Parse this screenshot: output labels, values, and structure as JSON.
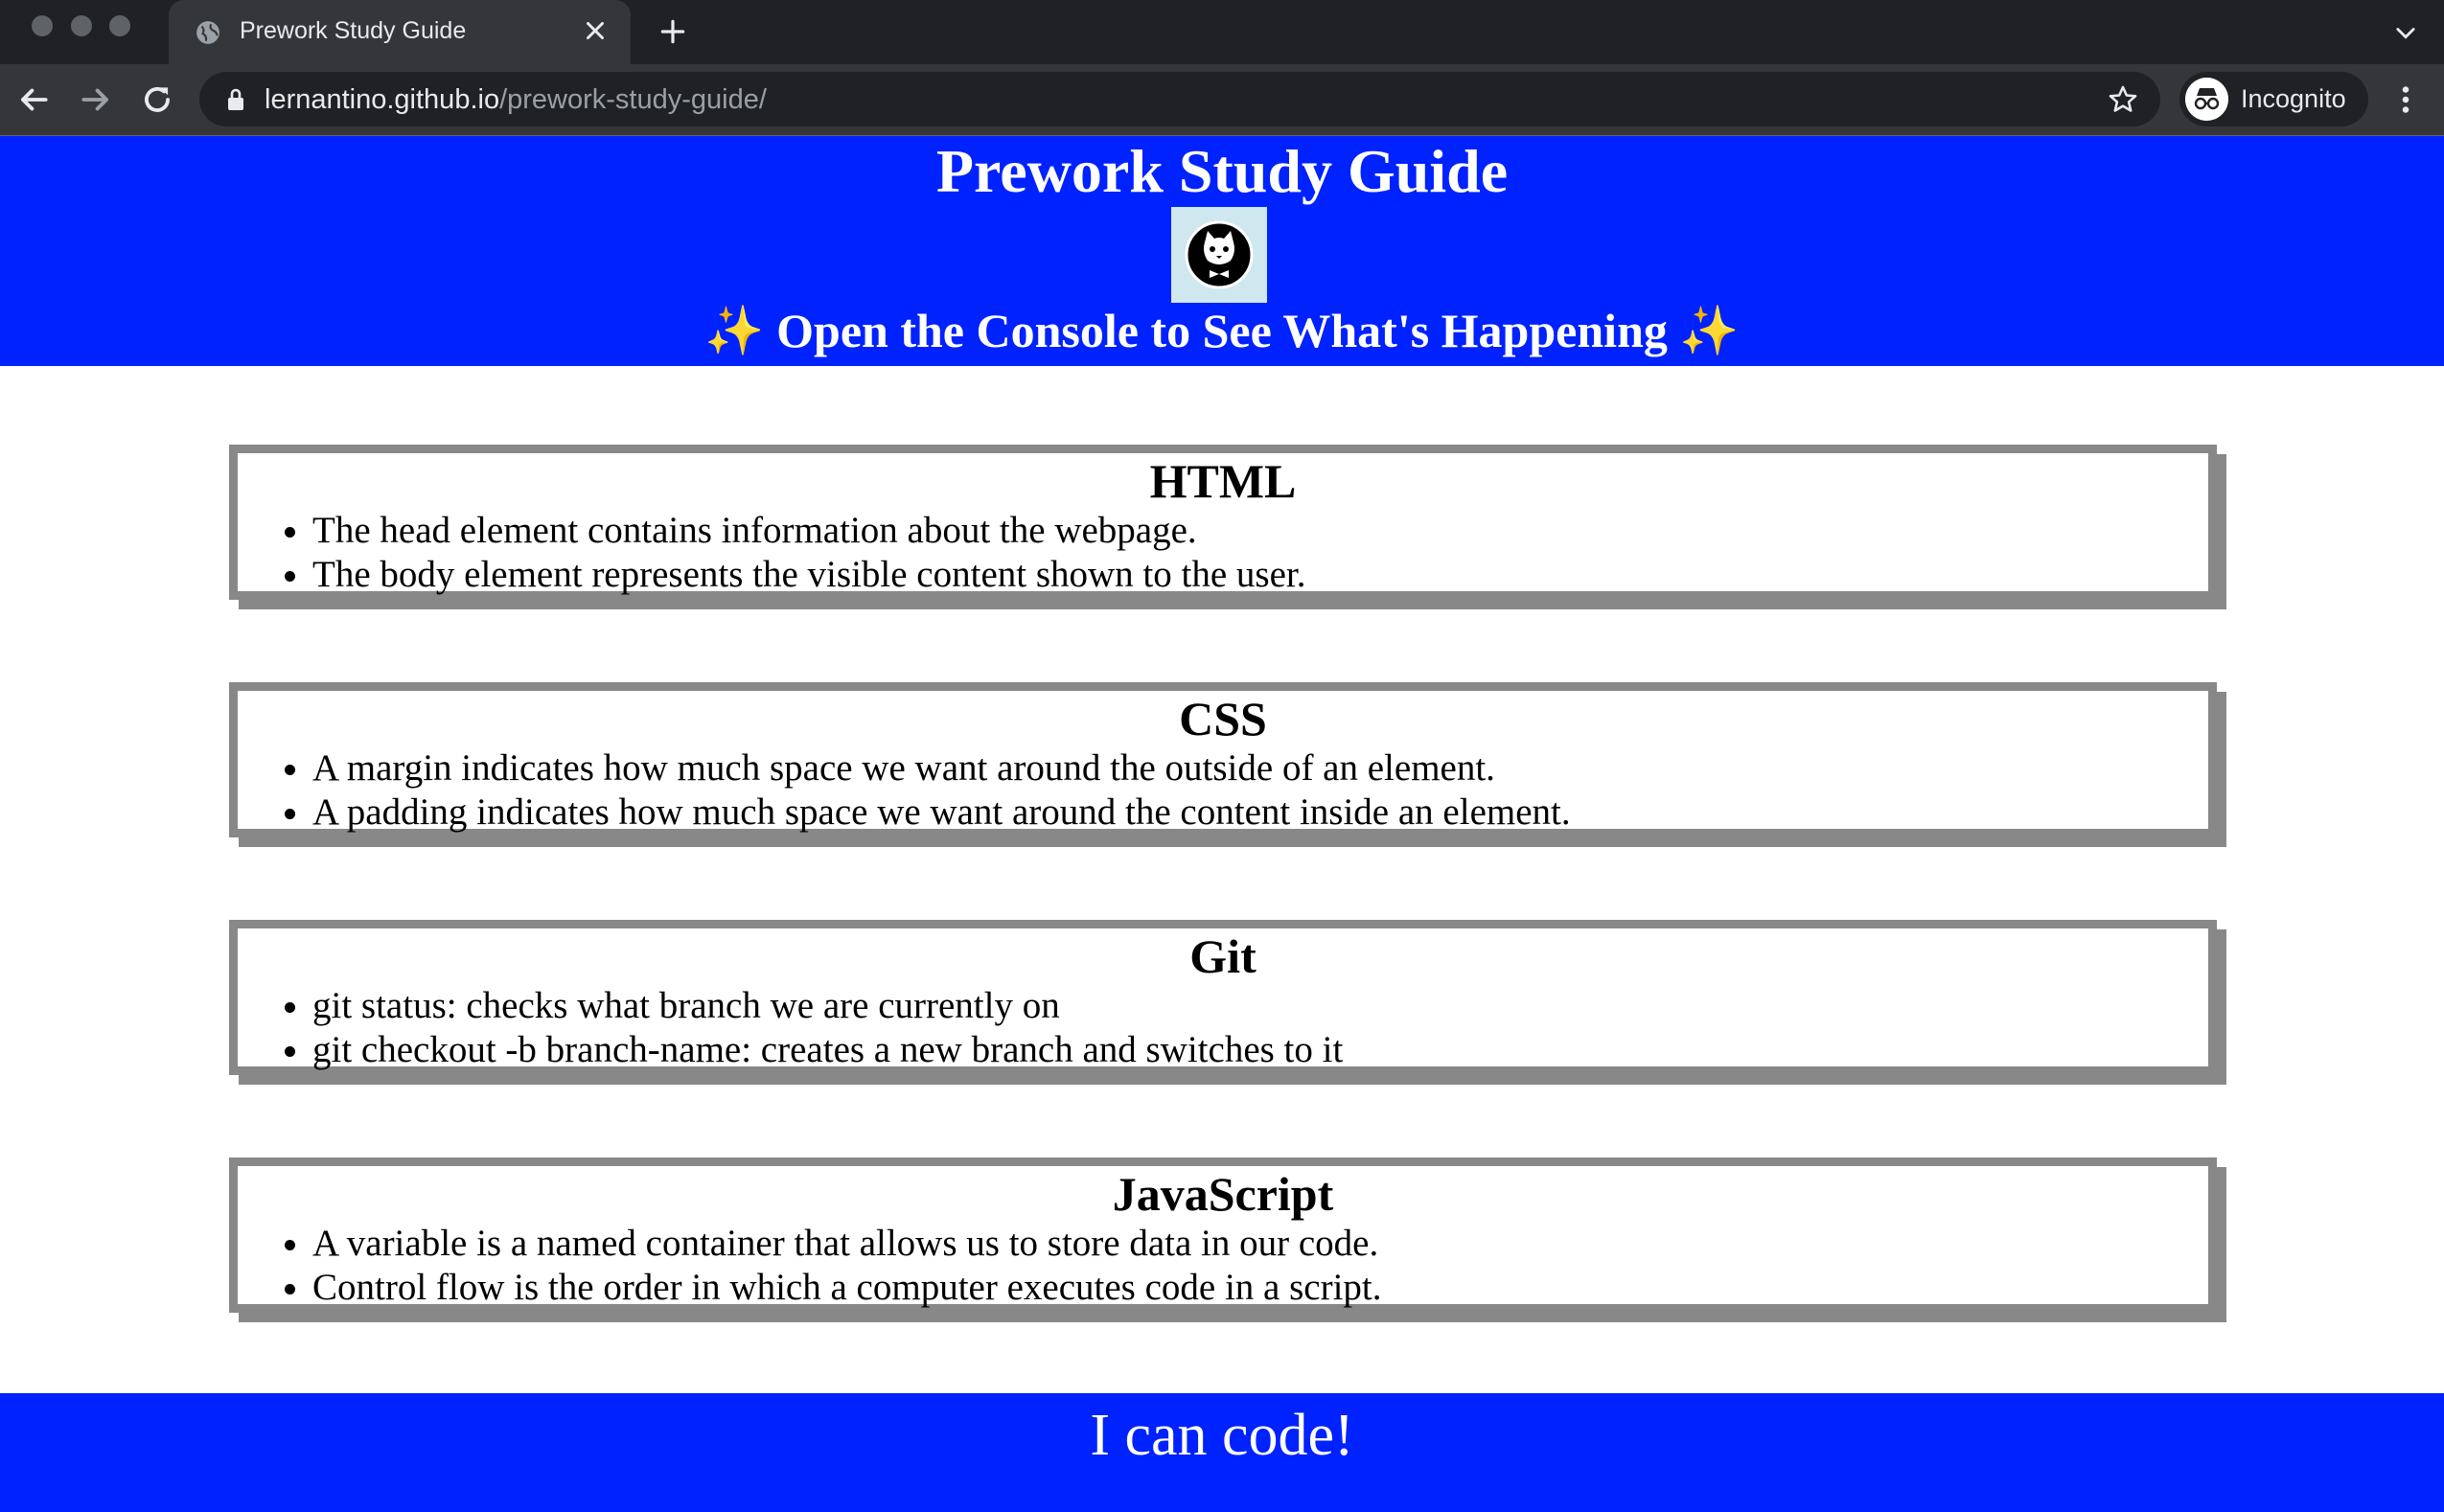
{
  "browser": {
    "tab_title": "Prework Study Guide",
    "url_domain": "lernantino.github.io",
    "url_path": "/prework-study-guide/",
    "profile_label": "Incognito",
    "icons": [
      "globe-icon",
      "close-icon",
      "plus-icon",
      "chevron-down-icon",
      "back-arrow-icon",
      "forward-arrow-icon",
      "reload-icon",
      "lock-icon",
      "star-icon",
      "incognito-icon",
      "more-vert-icon"
    ]
  },
  "header": {
    "title": "Prework Study Guide",
    "subtitle": "✨ Open the Console to See What's Happening ✨",
    "logo_icon": "cat-logo-icon"
  },
  "sections": [
    {
      "title": "HTML",
      "items": [
        "The head element contains information about the webpage.",
        "The body element represents the visible content shown to the user."
      ]
    },
    {
      "title": "CSS",
      "items": [
        "A margin indicates how much space we want around the outside of an element.",
        "A padding indicates how much space we want around the content inside an element."
      ]
    },
    {
      "title": "Git",
      "items": [
        "git status: checks what branch we are currently on",
        "git checkout -b branch-name: creates a new branch and switches to it"
      ]
    },
    {
      "title": "JavaScript",
      "items": [
        "A variable is a named container that allows us to store data in our code.",
        "Control flow is the order in which a computer executes code in a script."
      ]
    }
  ],
  "footer": {
    "text": "I can code!"
  },
  "colors": {
    "brand_blue": "#0022ff",
    "card_border": "#888888",
    "chrome_dark": "#202124",
    "chrome_toolbar": "#35363a"
  }
}
